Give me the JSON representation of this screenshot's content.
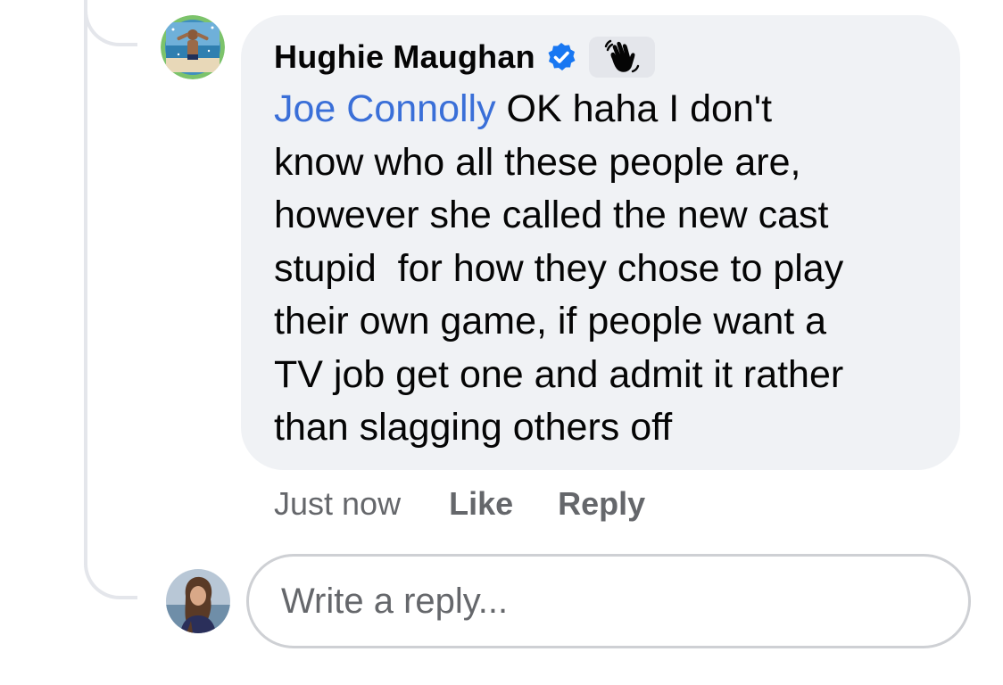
{
  "comment": {
    "author": "Hughie Maughan",
    "verified_icon": "verified-badge-icon",
    "badge_icon": "waving-hand-icon",
    "mention": "Joe Connolly",
    "text_lines": [
      " OK haha I don't",
      "know who all these people are,",
      "however she called the new cast",
      "stupid  for how they chose to play",
      "their own game, if people want a",
      "TV job get one and admit it rather",
      "than slagging others off"
    ],
    "timestamp": "Just now",
    "like_label": "Like",
    "reply_label": "Reply"
  },
  "reply_box": {
    "placeholder": "Write a reply..."
  },
  "colors": {
    "bubble_bg": "#f0f2f5",
    "mention": "#3a6fd8",
    "verified": "#1877f2",
    "meta_text": "#65676b",
    "thread_line": "#e4e6eb"
  }
}
